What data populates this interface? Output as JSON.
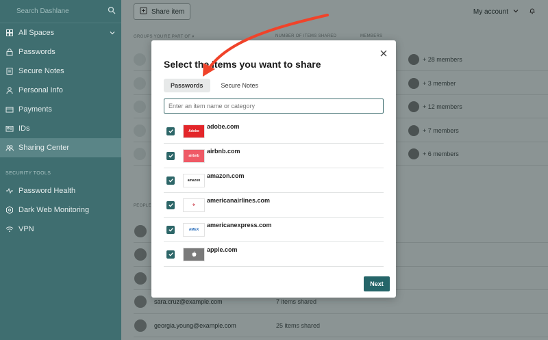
{
  "sidebar": {
    "search_placeholder": "Search Dashlane",
    "items": [
      {
        "label": "All Spaces",
        "icon": "stack-icon"
      },
      {
        "label": "Passwords",
        "icon": "lock-icon"
      },
      {
        "label": "Secure Notes",
        "icon": "note-icon"
      },
      {
        "label": "Personal Info",
        "icon": "person-icon"
      },
      {
        "label": "Payments",
        "icon": "card-icon"
      },
      {
        "label": "IDs",
        "icon": "id-icon"
      },
      {
        "label": "Sharing Center",
        "icon": "people-icon"
      }
    ],
    "security_label": "SECURITY TOOLS",
    "security_items": [
      {
        "label": "Password Health",
        "icon": "pulse-icon"
      },
      {
        "label": "Dark Web Monitoring",
        "icon": "radar-icon"
      },
      {
        "label": "VPN",
        "icon": "wifi-icon"
      }
    ]
  },
  "topbar": {
    "share_label": "Share item",
    "account_label": "My account"
  },
  "groups": {
    "col_groups": "GROUPS YOU'RE PART OF ▾",
    "col_items": "NUMBER OF ITEMS SHARED",
    "col_members": "MEMBERS",
    "rows": [
      {
        "members": "+ 28 members"
      },
      {
        "members": "+ 3 member"
      },
      {
        "members": "+ 12 members"
      },
      {
        "members": "+ 7 members"
      },
      {
        "members": "+ 6 members"
      }
    ]
  },
  "people": {
    "heading": "PEOPLE",
    "rows": [
      {
        "email": "",
        "count": ""
      },
      {
        "email": "",
        "count": ""
      },
      {
        "email": "",
        "count": ""
      },
      {
        "email": "sara.cruz@example.com",
        "count": "7 items shared"
      },
      {
        "email": "georgia.young@example.com",
        "count": "25 items shared"
      }
    ]
  },
  "modal": {
    "title": "Select the items you want to share",
    "tabs": [
      "Passwords",
      "Secure Notes"
    ],
    "search_placeholder": "Enter an item name or category",
    "items": [
      {
        "name": "adobe.com",
        "logo_text": "Adobe",
        "logo_bg": "#e3262a",
        "logo_fg": "#ffffff"
      },
      {
        "name": "airbnb.com",
        "logo_text": "airbnb",
        "logo_bg": "#ef5a66",
        "logo_fg": "#ffffff"
      },
      {
        "name": "amazon.com",
        "logo_text": "amazon",
        "logo_bg": "#ffffff",
        "logo_fg": "#222222"
      },
      {
        "name": "americanairlines.com",
        "logo_text": "✈",
        "logo_bg": "#ffffff",
        "logo_fg": "#c4202f"
      },
      {
        "name": "americanexpress.com",
        "logo_text": "AMEX",
        "logo_bg": "#ffffff",
        "logo_fg": "#2a6ebb"
      },
      {
        "name": "apple.com",
        "logo_text": "",
        "logo_bg": "#7a7a7a",
        "logo_fg": "#ffffff"
      }
    ],
    "next_label": "Next"
  },
  "colors": {
    "accent": "#256569",
    "annotation_arrow": "#f0432a"
  }
}
